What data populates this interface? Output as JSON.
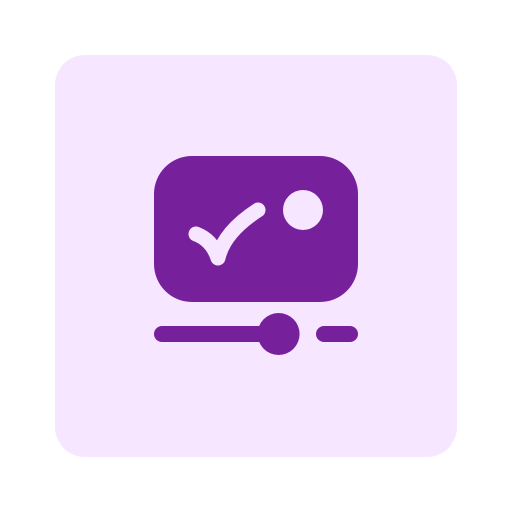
{
  "icon": {
    "name": "video-check-progress-icon",
    "tile_color": "#F7E6FF",
    "glyph_color": "#77209B",
    "accent_color": "#F7E6FF"
  },
  "progress": {
    "fraction": 0.62
  }
}
